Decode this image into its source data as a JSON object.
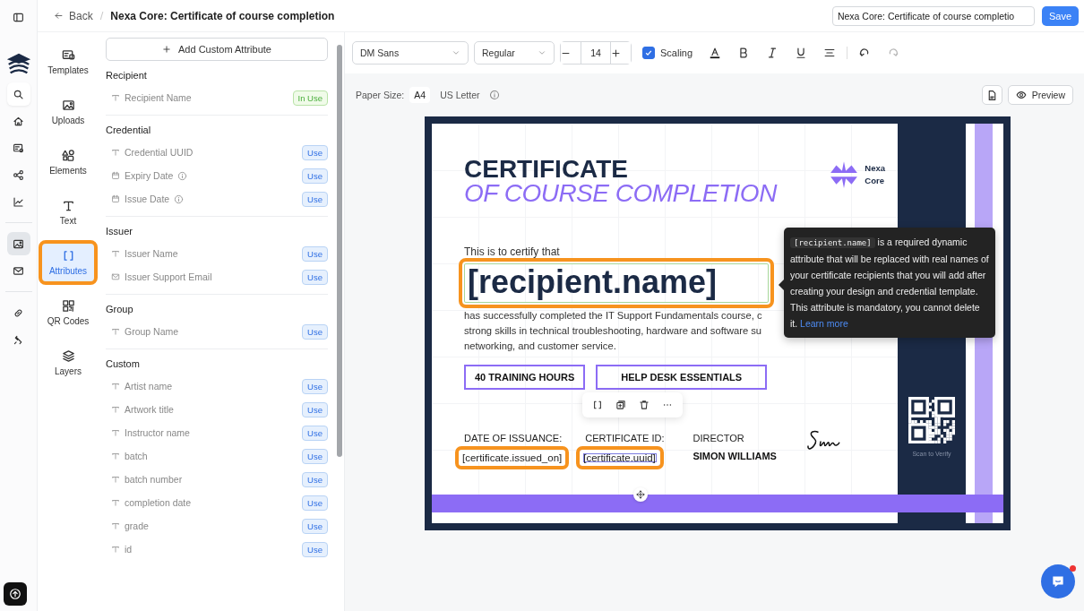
{
  "rail": [
    {
      "kind": "panel",
      "selected": false
    },
    {
      "kind": "logo"
    },
    {
      "kind": "search",
      "selected": false
    },
    {
      "kind": "home",
      "selected": false
    },
    {
      "kind": "certificate",
      "selected": false
    },
    {
      "kind": "share",
      "selected": false
    },
    {
      "kind": "chart",
      "selected": false
    },
    {
      "kind": "divider"
    },
    {
      "kind": "image",
      "selected": true
    },
    {
      "kind": "mail",
      "selected": false
    },
    {
      "kind": "divider"
    },
    {
      "kind": "link",
      "selected": false
    },
    {
      "kind": "pin",
      "selected": false
    }
  ],
  "header": {
    "back": "Back",
    "separator": "/",
    "title": "Nexa Core: Certificate of course completion",
    "title_field": "Nexa Core: Certificate of course completio",
    "save": "Save"
  },
  "nav": [
    {
      "kind": "templates",
      "label": "Templates",
      "selected": false,
      "highlighted": false
    },
    {
      "kind": "uploads",
      "label": "Uploads",
      "selected": false,
      "highlighted": false
    },
    {
      "kind": "elements",
      "label": "Elements",
      "selected": false,
      "highlighted": false
    },
    {
      "kind": "text",
      "label": "Text",
      "selected": false,
      "highlighted": false
    },
    {
      "kind": "attributes",
      "label": "Attributes",
      "selected": true,
      "highlighted": true
    },
    {
      "kind": "qr",
      "label": "QR Codes",
      "selected": false,
      "highlighted": false
    },
    {
      "kind": "layers",
      "label": "Layers",
      "selected": false,
      "highlighted": false
    }
  ],
  "attributes": {
    "add_button": "Add Custom Attribute",
    "sections": [
      {
        "title": "Recipient",
        "items": [
          {
            "kind": "text",
            "label": "Recipient Name",
            "info": false,
            "in_use": true,
            "button": "In Use"
          }
        ]
      },
      {
        "title": "Credential",
        "items": [
          {
            "kind": "text",
            "label": "Credential UUID",
            "info": false,
            "in_use": false,
            "button": "Use"
          },
          {
            "kind": "date",
            "label": "Expiry Date",
            "info": true,
            "in_use": false,
            "button": "Use"
          },
          {
            "kind": "date",
            "label": "Issue Date",
            "info": true,
            "in_use": false,
            "button": "Use"
          }
        ]
      },
      {
        "title": "Issuer",
        "items": [
          {
            "kind": "text",
            "label": "Issuer Name",
            "info": false,
            "in_use": false,
            "button": "Use"
          },
          {
            "kind": "mail",
            "label": "Issuer Support Email",
            "info": false,
            "in_use": false,
            "button": "Use"
          }
        ]
      },
      {
        "title": "Group",
        "items": [
          {
            "kind": "text",
            "label": "Group Name",
            "info": false,
            "in_use": false,
            "button": "Use"
          }
        ]
      },
      {
        "title": "Custom",
        "items": [
          {
            "kind": "text",
            "label": "Artist name",
            "info": false,
            "in_use": false,
            "button": "Use"
          },
          {
            "kind": "text",
            "label": "Artwork title",
            "info": false,
            "in_use": false,
            "button": "Use"
          },
          {
            "kind": "text",
            "label": "Instructor name",
            "info": false,
            "in_use": false,
            "button": "Use"
          },
          {
            "kind": "text",
            "label": "batch",
            "info": false,
            "in_use": false,
            "button": "Use"
          },
          {
            "kind": "text",
            "label": "batch number",
            "info": false,
            "in_use": false,
            "button": "Use"
          },
          {
            "kind": "text",
            "label": "completion date",
            "info": false,
            "in_use": false,
            "button": "Use"
          },
          {
            "kind": "text",
            "label": "grade",
            "info": false,
            "in_use": false,
            "button": "Use"
          },
          {
            "kind": "text",
            "label": "id",
            "info": false,
            "in_use": false,
            "button": "Use"
          }
        ]
      }
    ]
  },
  "toolbar": {
    "font": "DM Sans",
    "weight": "Regular",
    "size": "14",
    "scaling": {
      "label": "Scaling",
      "checked": true
    },
    "redo_disabled": true
  },
  "paper": {
    "label": "Paper Size:",
    "options": [
      {
        "label": "A4",
        "selected": true
      },
      {
        "label": "US Letter",
        "selected": false
      }
    ],
    "preview": "Preview"
  },
  "certificate": {
    "title": "CERTIFICATE",
    "subtitle": "OF COURSE COMPLETION",
    "brand": [
      "Nexa",
      "Core"
    ],
    "intro": "This is to certify that",
    "recipient": {
      "value": "[recipient.name]",
      "highlighted": true
    },
    "body_lines": [
      "has successfully completed the IT Support Fundamentals course, c",
      "strong skills in technical troubleshooting, hardware and software su",
      "networking, and customer service."
    ],
    "badges": [
      "40 TRAINING HOURS",
      "HELP DESK ESSENTIALS"
    ],
    "fields": [
      {
        "label": "DATE OF ISSUANCE:",
        "value": "[certificate.issued_on]",
        "highlighted": true,
        "selected": false
      },
      {
        "label": "CERTIFICATE ID:",
        "value": "[certificate.uuid]",
        "highlighted": true,
        "selected": true
      }
    ],
    "director_label": "DIRECTOR",
    "director_name": "SIMON WILLIAMS",
    "qr_caption": "Scan to Verify"
  },
  "tooltip": {
    "code": "[recipient.name]",
    "text": " is a required dynamic attribute that will be replaced with real names of your certificate recipients that you will add after creating your design and credential template. This attribute is mandatory, you cannot delete it. ",
    "link": "Learn more"
  }
}
